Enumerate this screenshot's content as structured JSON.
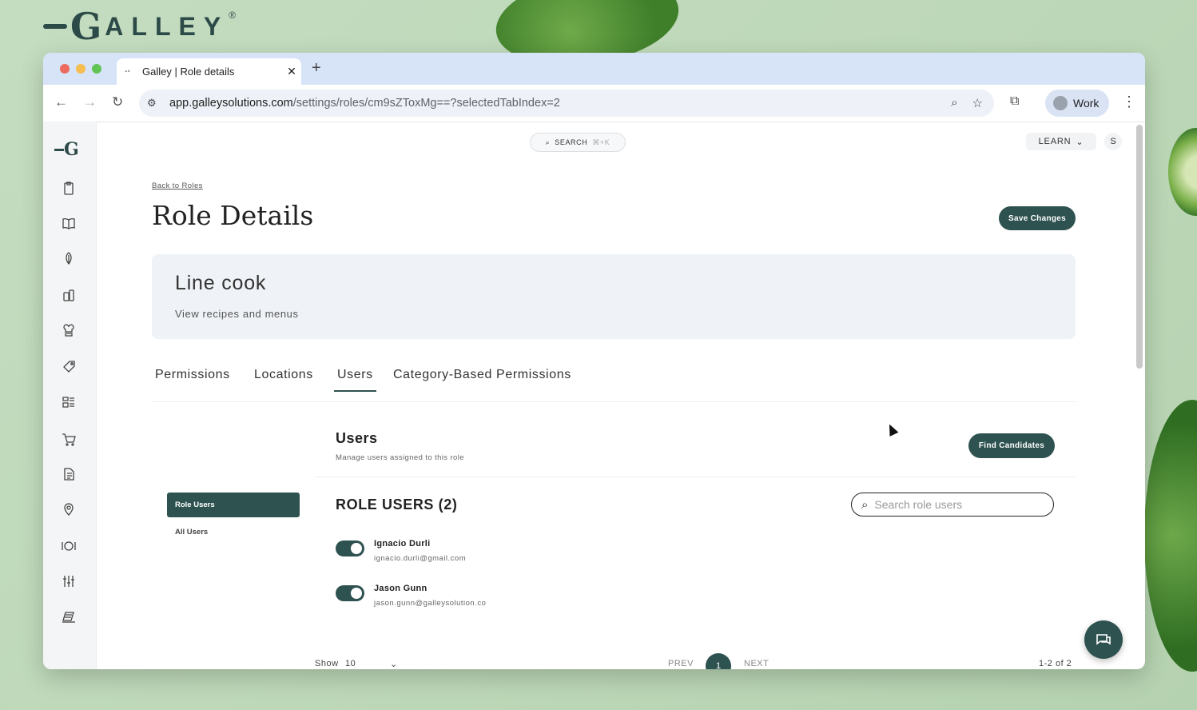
{
  "brand": {
    "name": "ALLEY",
    "letter": "G",
    "reg": "®"
  },
  "browser": {
    "tab_title": "Galley | Role details",
    "url_host": "app.galleysolutions.com",
    "url_path": "/settings/roles/cm9sZToxMg==?selectedTabIndex=2",
    "profile_label": "Work"
  },
  "topbar": {
    "search_label": "SEARCH",
    "search_shortcut": "⌘+K",
    "learn_label": "LEARN",
    "avatar_initial": "S"
  },
  "sidebar": {
    "logo": "G",
    "icons": [
      "clipboard-icon",
      "book-icon",
      "vegetable-icon",
      "ingredients-icon",
      "chef-icon",
      "tag-icon",
      "menu-list-icon",
      "cart-icon",
      "document-icon",
      "location-icon",
      "dining-icon",
      "sliders-icon",
      "reports-icon"
    ]
  },
  "page": {
    "back_link": "Back to Roles",
    "title": "Role Details",
    "save_label": "Save Changes",
    "role_name": "Line cook",
    "role_description": "View recipes and menus",
    "tabs": [
      "Permissions",
      "Locations",
      "Users",
      "Category-Based Permissions"
    ],
    "active_tab": "Users"
  },
  "users_section": {
    "heading": "Users",
    "subheading": "Manage users assigned to this role",
    "find_label": "Find Candidates",
    "subnav": [
      "Role Users",
      "All Users"
    ],
    "list_heading": "ROLE USERS (2)",
    "search_placeholder": "Search role users",
    "users": [
      {
        "name": "Ignacio Durli",
        "email": "ignacio.durli@gmail.com",
        "enabled": true
      },
      {
        "name": "Jason Gunn",
        "email": "jason.gunn@galleysolution.co",
        "enabled": true
      }
    ]
  },
  "pagination": {
    "show_label": "Show",
    "show_value": "10",
    "prev": "PREV",
    "page": "1",
    "next": "NEXT",
    "range": "1-2 of 2"
  },
  "colors": {
    "primary": "#2e5250",
    "card_bg": "#eff2f7",
    "browser_chrome": "#d7e3f7"
  }
}
